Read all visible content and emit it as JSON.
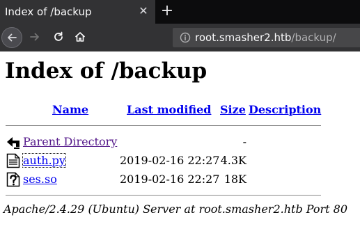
{
  "browser": {
    "tab": {
      "title": "Index of /backup",
      "close_glyph": "✕"
    },
    "new_tab_glyph": "+",
    "url": {
      "host": "root.smasher2.htb",
      "path": "/backup/"
    }
  },
  "page": {
    "heading": "Index of /backup",
    "columns": {
      "name": "Name",
      "last_modified": "Last modified",
      "size": "Size",
      "description": "Description"
    },
    "rows": [
      {
        "icon": "back-arrow-icon",
        "name": "Parent Directory",
        "last_modified": "",
        "size": "-",
        "description": ""
      },
      {
        "icon": "text-file-icon",
        "name": "auth.py",
        "last_modified": "2019-02-16 22:27",
        "size": "4.3K",
        "description": ""
      },
      {
        "icon": "unknown-file-icon",
        "name": "ses.so",
        "last_modified": "2019-02-16 22:27",
        "size": "18K",
        "description": ""
      }
    ],
    "footer": "Apache/2.4.29 (Ubuntu) Server at root.smasher2.htb Port 80"
  },
  "colors": {
    "link": "#0000ee",
    "visited": "#551a8b",
    "chrome_dark": "#0c0c0d",
    "chrome": "#323234"
  }
}
